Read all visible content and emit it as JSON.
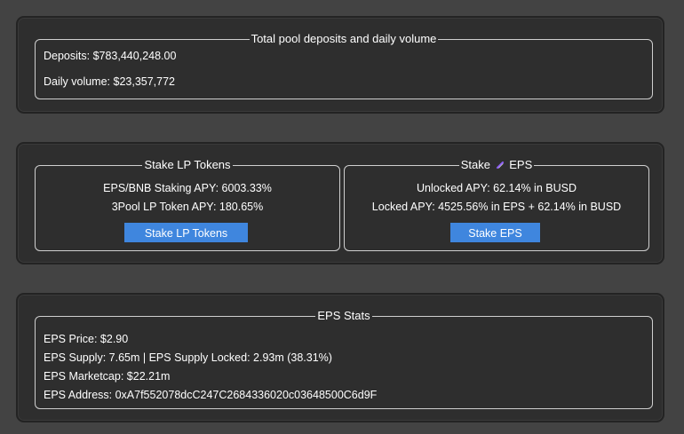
{
  "pool": {
    "legend": "Total pool deposits and daily volume",
    "deposits": "Deposits: $783,440,248.00",
    "daily_volume": "Daily volume: $23,357,772"
  },
  "stake_lp": {
    "legend": "Stake LP Tokens",
    "eps_bnb_apy": "EPS/BNB Staking APY: 6003.33%",
    "three_pool_apy": "3Pool LP Token APY: 180.65%",
    "button_label": "Stake LP Tokens"
  },
  "stake_eps": {
    "legend_prefix": "Stake",
    "legend_suffix": "EPS",
    "unlocked_apy": "Unlocked APY: 62.14% in BUSD",
    "locked_apy": "Locked APY: 4525.56% in EPS + 62.14% in BUSD",
    "button_label": "Stake EPS",
    "icon": "eps-token-icon"
  },
  "stats": {
    "legend": "EPS Stats",
    "price": "EPS Price: $2.90",
    "supply": "EPS Supply: 7.65m | EPS Supply Locked: 2.93m (38.31%)",
    "marketcap": "EPS Marketcap: $22.21m",
    "address": "EPS Address: 0xA7f552078dcC247C2684336020c03648500C6d9F"
  },
  "colors": {
    "page_background": "#434343",
    "panel_background": "#2e2e2e",
    "button_accent": "#3f86de",
    "border": "#cfcfcf"
  }
}
